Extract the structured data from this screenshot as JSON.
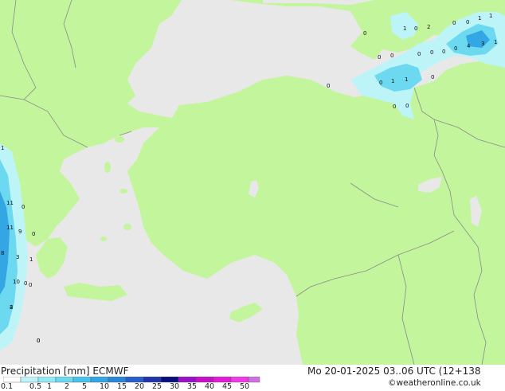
{
  "map": {
    "colors": {
      "sea": "#e8e8e8",
      "land": "#c2f59c",
      "border": "#8a8a8a"
    },
    "precip_labels": [
      "0",
      "1",
      "0",
      "2",
      "0",
      "0",
      "1",
      "1",
      "0",
      "0",
      "0",
      "0",
      "0",
      "0",
      "4",
      "3",
      "1",
      "0",
      "0",
      "1",
      "1",
      "0",
      "0",
      "0",
      "0",
      "0",
      "4",
      "1",
      "11",
      "0",
      "11",
      "9",
      "0",
      "8",
      "3",
      "1",
      "10",
      "0",
      "2",
      "0"
    ]
  },
  "footer": {
    "title": "Precipitation [mm]",
    "model": "ECMWF",
    "datetime": "Mo 20-01-2025 03..06 UTC (12+138",
    "credit": "©weatheronline.co.uk",
    "scale": {
      "ticks": [
        "0.1",
        "0.5",
        "1",
        "2",
        "5",
        "10",
        "15",
        "20",
        "25",
        "30",
        "35",
        "40",
        "45",
        "50"
      ],
      "colors": [
        "#ffffff",
        "#bdf4f8",
        "#93e9f5",
        "#6cd9f0",
        "#49c3ec",
        "#34a6e4",
        "#2b85d8",
        "#2a5ec8",
        "#1f35a9",
        "#0a0f7e",
        "#9a11c8",
        "#c80fc8",
        "#e21bd6",
        "#f03be4",
        "#d070e0"
      ]
    }
  }
}
